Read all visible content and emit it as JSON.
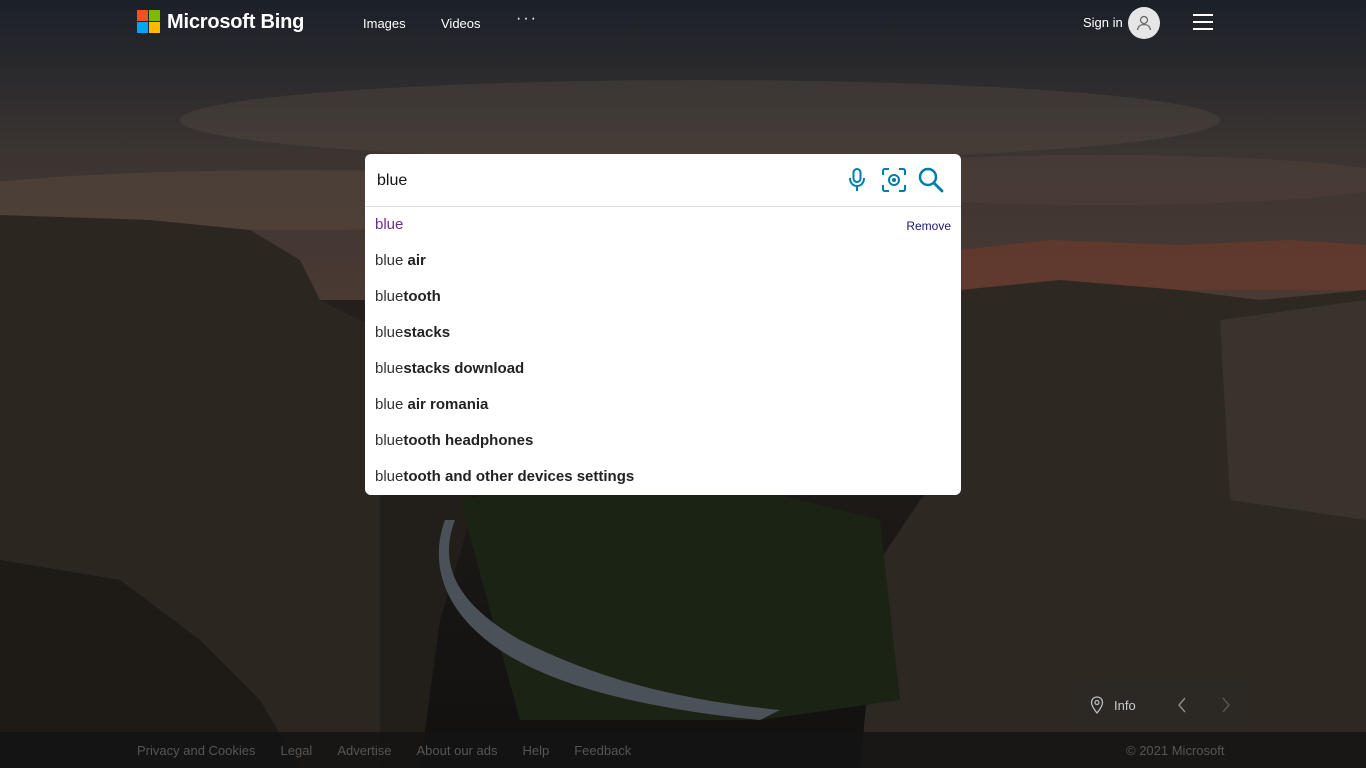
{
  "header": {
    "logo_text": "Microsoft Bing",
    "nav": [
      {
        "label": "Images"
      },
      {
        "label": "Videos"
      },
      {
        "label": "···"
      }
    ],
    "signin_label": "Sign in"
  },
  "search": {
    "value": "blue",
    "remove_label": "Remove",
    "suggestions": [
      {
        "prefix": "blue",
        "bold": ""
      },
      {
        "prefix": "blue ",
        "bold": "air"
      },
      {
        "prefix": "blue",
        "bold": "tooth"
      },
      {
        "prefix": "blue",
        "bold": "stacks"
      },
      {
        "prefix": "blue",
        "bold": "stacks download"
      },
      {
        "prefix": "blue ",
        "bold": "air romania"
      },
      {
        "prefix": "blue",
        "bold": "tooth headphones"
      },
      {
        "prefix": "blue",
        "bold": "tooth and other devices settings"
      }
    ]
  },
  "info": {
    "label": "Info"
  },
  "footer": {
    "links": [
      "Privacy and Cookies",
      "Legal",
      "Advertise",
      "About our ads",
      "Help",
      "Feedback"
    ],
    "copyright": "© 2021 Microsoft"
  },
  "icons": {
    "search": "search-icon",
    "mic": "microphone-icon",
    "visual": "visual-search-icon",
    "avatar": "user-icon",
    "menu": "hamburger-icon",
    "location": "location-pin-icon"
  },
  "colors": {
    "accent": "#007daa",
    "first_suggestion": "#6b2d8f"
  }
}
